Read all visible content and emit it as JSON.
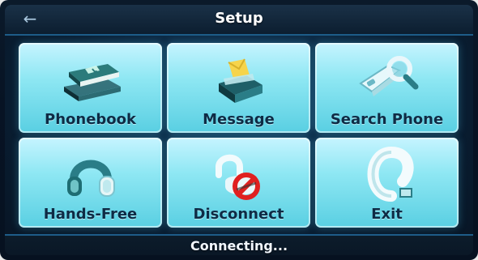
{
  "header": {
    "title": "Setup",
    "back_icon": "back-arrow-icon"
  },
  "menu": {
    "items": [
      {
        "label": "Phonebook",
        "icon": "phonebook-icon"
      },
      {
        "label": "Message",
        "icon": "message-icon"
      },
      {
        "label": "Search Phone",
        "icon": "search-phone-icon"
      },
      {
        "label": "Hands-Free",
        "icon": "headphones-icon"
      },
      {
        "label": "Disconnect",
        "icon": "disconnect-icon"
      },
      {
        "label": "Exit",
        "icon": "exit-icon"
      }
    ]
  },
  "footer": {
    "status": "Connecting..."
  },
  "colors": {
    "tile_top": "#c6f4ff",
    "tile_bottom": "#59cfe2",
    "accent_blue": "#1e5c88",
    "label_text": "#0e2b45",
    "prohibited_red": "#e02020"
  }
}
